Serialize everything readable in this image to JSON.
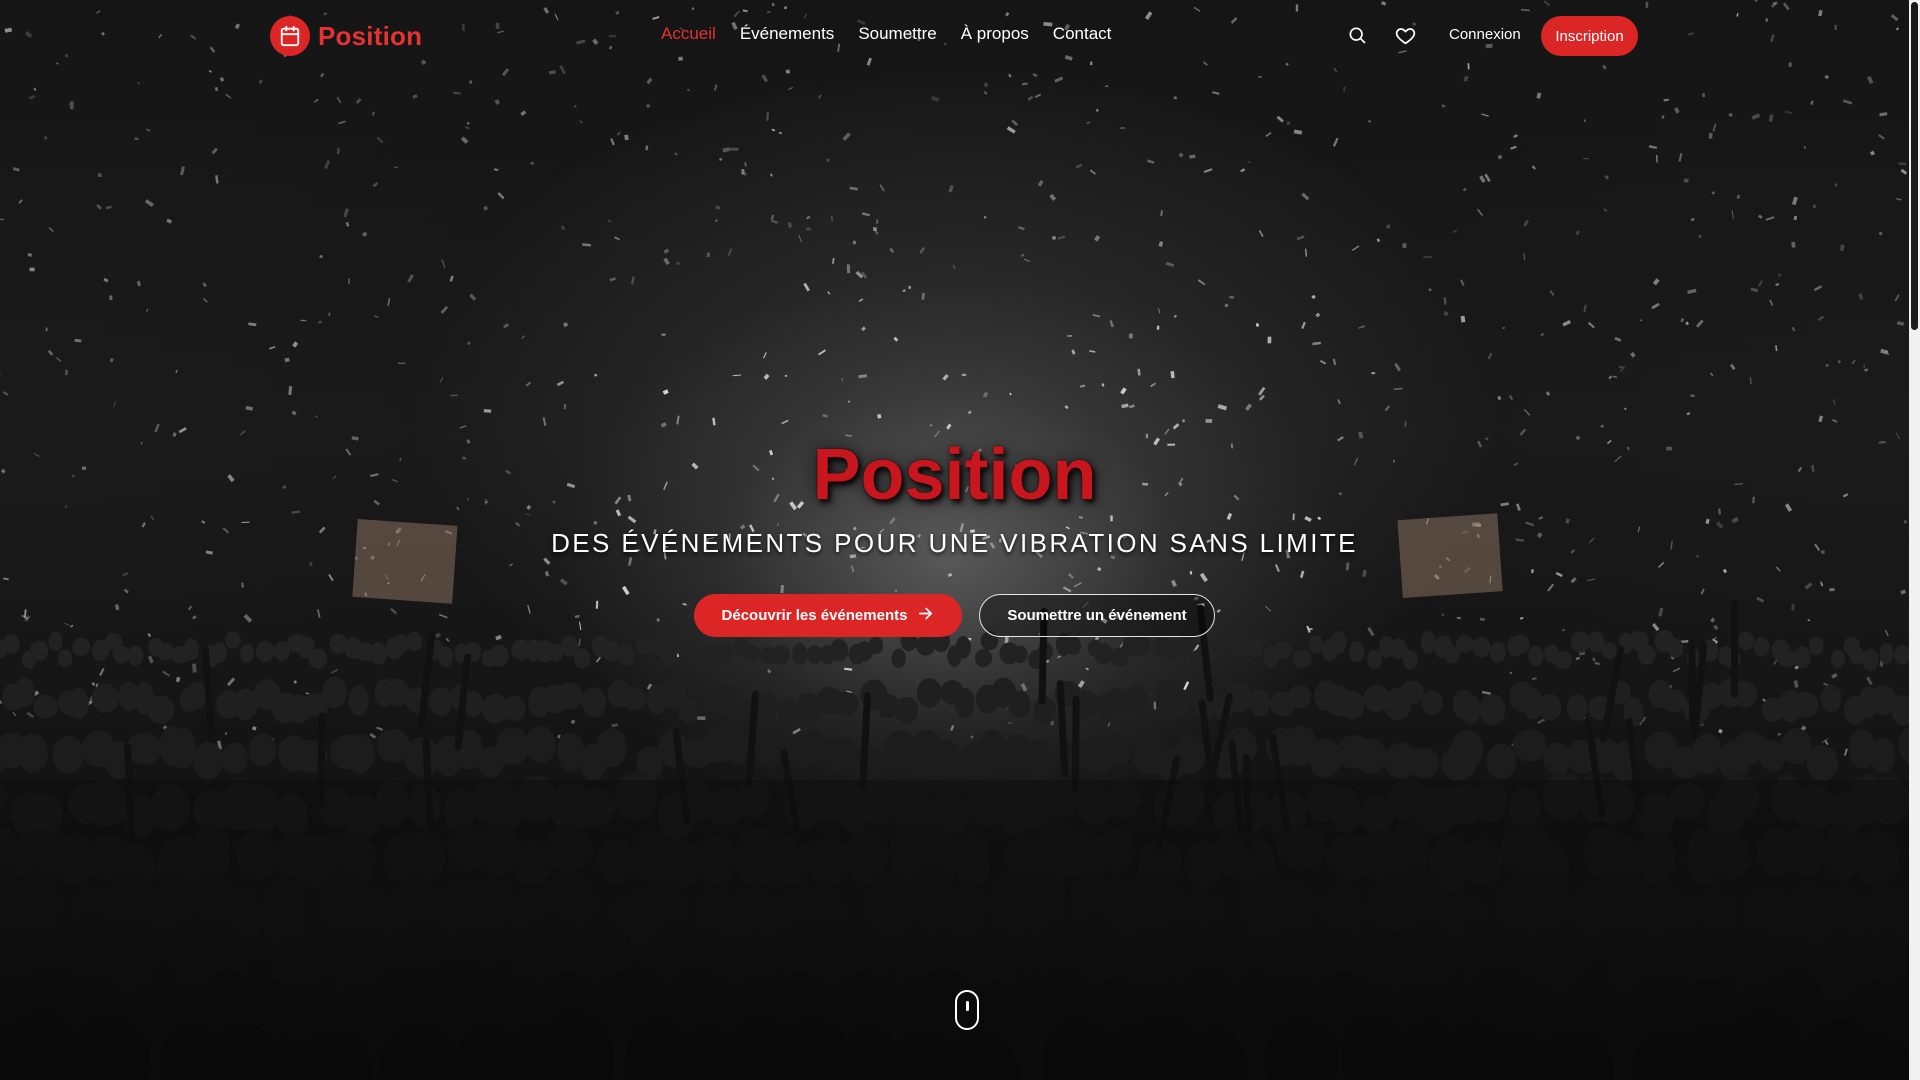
{
  "brand": {
    "name": "Position",
    "icon": "calendar-icon",
    "color": "#e63232"
  },
  "nav": {
    "items": [
      {
        "label": "Accueil",
        "active": true
      },
      {
        "label": "Événements",
        "active": false
      },
      {
        "label": "Soumettre",
        "active": false
      },
      {
        "label": "À propos",
        "active": false
      },
      {
        "label": "Contact",
        "active": false
      }
    ],
    "search_icon": "search-icon",
    "favorites_icon": "heart-icon",
    "login_label": "Connexion",
    "signup_label": "Inscription"
  },
  "hero": {
    "title": "Position",
    "subtitle": "DES ÉVÉNEMENTS POUR UNE VIBRATION SANS LIMITE",
    "primary_cta": "Découvrir les événements",
    "primary_cta_icon": "arrow-right-icon",
    "secondary_cta": "Soumettre un événement",
    "scroll_icon": "mouse-scroll-icon"
  },
  "colors": {
    "accent": "#dc2626",
    "accent_text": "#e63232",
    "text": "#ffffff"
  }
}
